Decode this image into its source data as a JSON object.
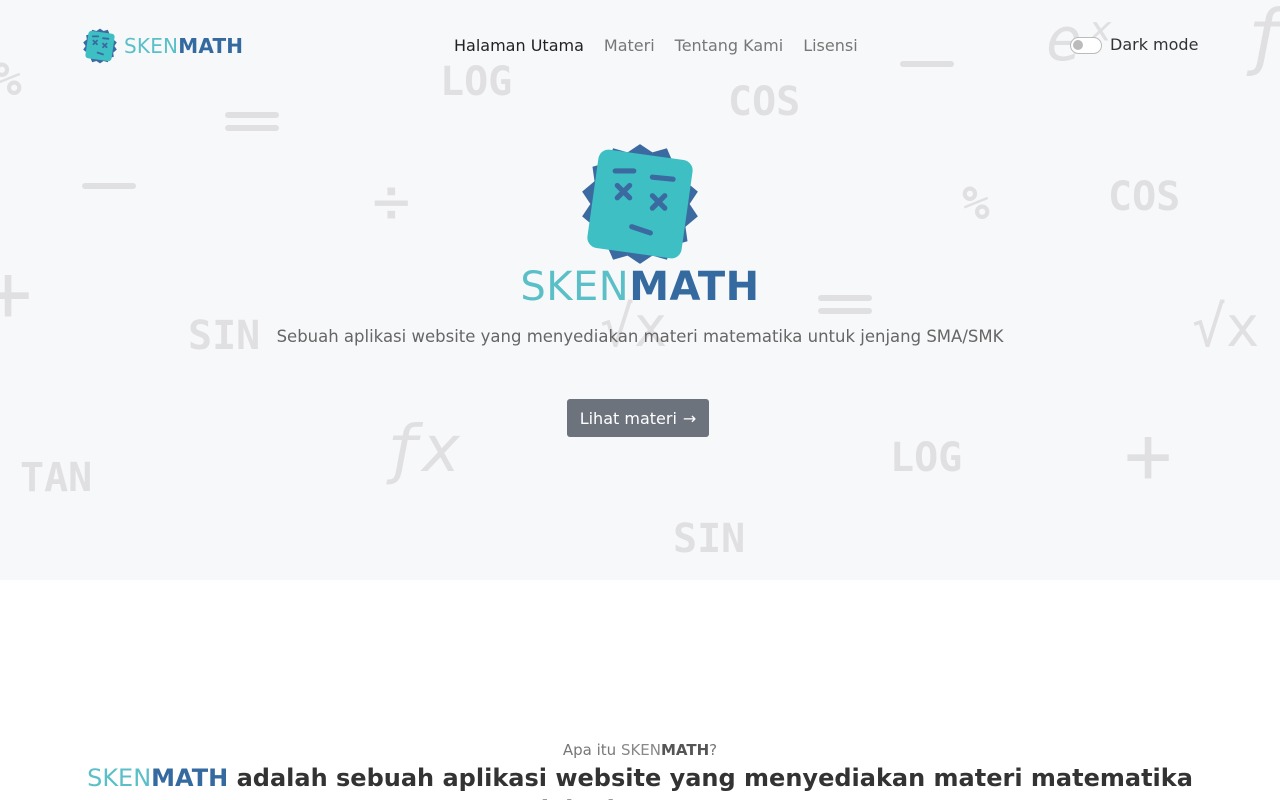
{
  "brand": {
    "part1": "SKEN",
    "part2": "MATH"
  },
  "nav": {
    "items": [
      {
        "label": "Halaman Utama",
        "active": true
      },
      {
        "label": "Materi",
        "active": false
      },
      {
        "label": "Tentang Kami",
        "active": false
      },
      {
        "label": "Lisensi",
        "active": false
      }
    ]
  },
  "dark_mode": {
    "label": "Dark mode",
    "enabled": false
  },
  "hero": {
    "title_part1": "SKEN",
    "title_part2": "MATH",
    "subtitle": "Sebuah aplikasi website yang menyediakan materi matematika untuk jenjang SMA/SMK",
    "cta_label": "Lihat materi",
    "cta_arrow": "→"
  },
  "about": {
    "kicker_prefix": "Apa itu ",
    "kicker_suffix": "?",
    "heading_rest": " adalah sebuah aplikasi website yang menyediakan materi matematika untuk jenjang SMA/SMK"
  },
  "background_symbols": [
    "LOG",
    "COS",
    "COS",
    "SIN",
    "TAN",
    "LOG",
    "SIN",
    "ƒx",
    "√x",
    "√x",
    "eˣ",
    "ƒx",
    "%",
    "%",
    "÷",
    "+",
    "+"
  ],
  "colors": {
    "brand_light": "#5bbfc8",
    "brand_dark": "#346aa0",
    "hero_bg": "#f7f8fa",
    "button_bg": "#6c737d",
    "symbol": "#e0e0e2"
  },
  "icons": {
    "logo": "confused-face-badge-icon",
    "arrow": "arrow-right-icon"
  }
}
